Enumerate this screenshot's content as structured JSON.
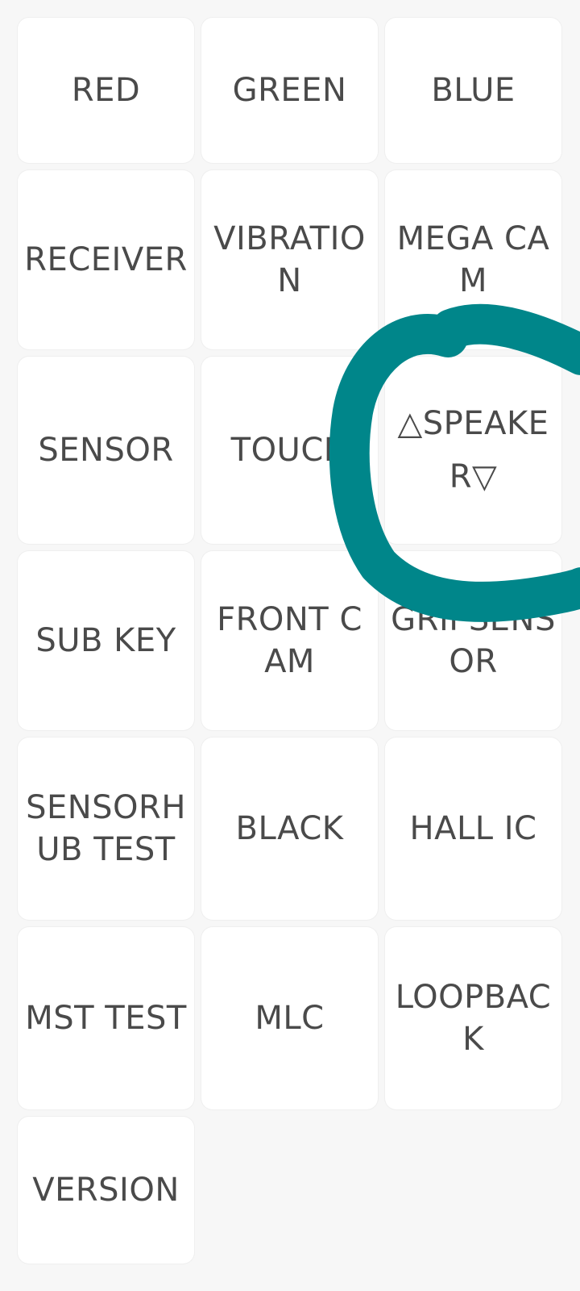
{
  "menu": {
    "items": [
      {
        "label": "RED"
      },
      {
        "label": "GREEN"
      },
      {
        "label": "BLUE"
      },
      {
        "label": "RECEIVER"
      },
      {
        "label": "VIBRATION"
      },
      {
        "label": "MEGA CAM"
      },
      {
        "label": "SENSOR"
      },
      {
        "label": "TOUCH"
      },
      {
        "label": "△SPEAKER▽"
      },
      {
        "label": "SUB KEY"
      },
      {
        "label": "FRONT CAM"
      },
      {
        "label": "GRIPSENSOR"
      },
      {
        "label": "SENSORHUB TEST"
      },
      {
        "label": "BLACK"
      },
      {
        "label": "HALL IC"
      },
      {
        "label": "MST TEST"
      },
      {
        "label": "MLC"
      },
      {
        "label": "LOOPBACK"
      },
      {
        "label": "VERSION"
      }
    ]
  },
  "annotation": {
    "color": "#00868a",
    "shape": "hand-drawn circle"
  }
}
